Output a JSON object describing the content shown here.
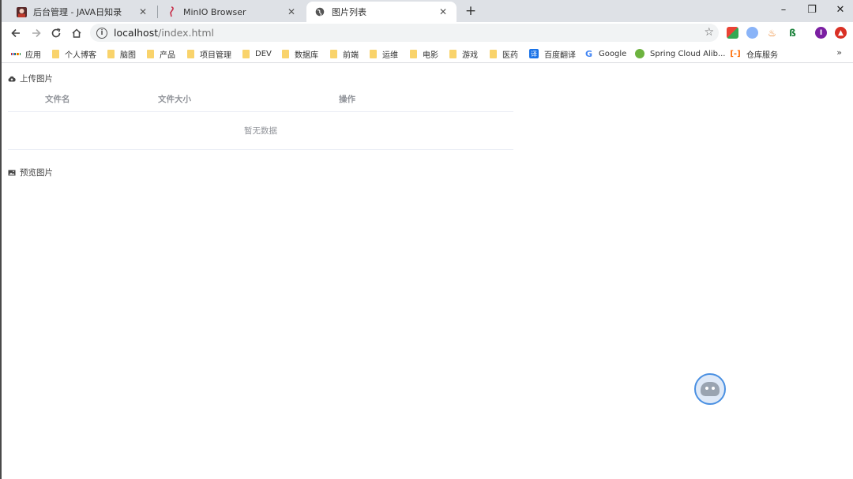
{
  "browser": {
    "tabs": [
      {
        "title": "后台管理 - JAVA日知录",
        "favicon": "avatar-icon"
      },
      {
        "title": "MinIO Browser",
        "favicon": "minio-flamingo-icon"
      },
      {
        "title": "图片列表",
        "favicon": "globe-icon"
      }
    ],
    "new_tab": "+",
    "window_controls": {
      "minimize": "–",
      "restore": "❐",
      "close": "✕"
    },
    "address": {
      "host": "localhost",
      "path": "/index.html"
    },
    "bookmarks": [
      {
        "label": "应用",
        "icon": "apps-grid-icon"
      },
      {
        "label": "个人博客",
        "icon": "folder-icon"
      },
      {
        "label": "脑图",
        "icon": "folder-icon"
      },
      {
        "label": "产品",
        "icon": "folder-icon"
      },
      {
        "label": "项目管理",
        "icon": "folder-icon"
      },
      {
        "label": "DEV",
        "icon": "folder-icon"
      },
      {
        "label": "数据库",
        "icon": "folder-icon"
      },
      {
        "label": "前端",
        "icon": "folder-icon"
      },
      {
        "label": "运维",
        "icon": "folder-icon"
      },
      {
        "label": "电影",
        "icon": "folder-icon"
      },
      {
        "label": "游戏",
        "icon": "folder-icon"
      },
      {
        "label": "医药",
        "icon": "folder-icon"
      },
      {
        "label": "百度翻译",
        "icon": "translate-icon"
      },
      {
        "label": "Google",
        "icon": "google-icon"
      },
      {
        "label": "Spring Cloud Alib...",
        "icon": "spring-icon"
      },
      {
        "label": "仓库服务",
        "icon": "aliyun-icon"
      }
    ],
    "bookmarks_more": "»",
    "profile_initial": "I"
  },
  "page": {
    "upload_title": "上传图片",
    "table": {
      "columns": [
        "文件名",
        "文件大小",
        "操作"
      ],
      "empty_text": "暂无数据"
    },
    "preview_title": "预览图片"
  },
  "colors": {
    "tab_strip": "#dee1e6",
    "table_header_text": "#909399",
    "table_border": "#ebeef5",
    "folder": "#f9d36b"
  }
}
